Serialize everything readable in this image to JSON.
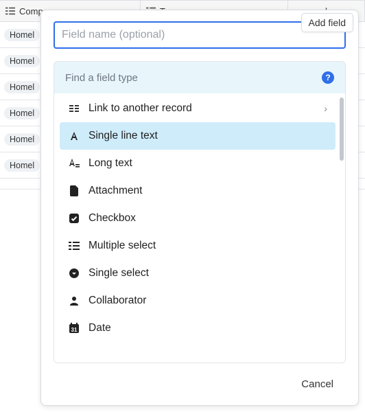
{
  "columns": {
    "company": "Company",
    "tags": "Tags"
  },
  "rows": [
    {
      "company_token": "Homel"
    },
    {
      "company_token": "Homel"
    },
    {
      "company_token": "Homel"
    },
    {
      "company_token": "Homel"
    },
    {
      "company_token": "Homel"
    },
    {
      "company_token": "Homel"
    }
  ],
  "tooltip": {
    "add_field": "Add field"
  },
  "dialog": {
    "fieldname_placeholder": "Field name (optional)",
    "fieldname_value": "",
    "type_search_label": "Find a field type",
    "cancel_label": "Cancel",
    "types": [
      {
        "key": "link",
        "label": "Link to another record",
        "has_submenu": true,
        "selected": false
      },
      {
        "key": "single_line",
        "label": "Single line text",
        "has_submenu": false,
        "selected": true
      },
      {
        "key": "long_text",
        "label": "Long text",
        "has_submenu": false,
        "selected": false
      },
      {
        "key": "attachment",
        "label": "Attachment",
        "has_submenu": false,
        "selected": false
      },
      {
        "key": "checkbox",
        "label": "Checkbox",
        "has_submenu": false,
        "selected": false
      },
      {
        "key": "multi_select",
        "label": "Multiple select",
        "has_submenu": false,
        "selected": false
      },
      {
        "key": "single_select",
        "label": "Single select",
        "has_submenu": false,
        "selected": false
      },
      {
        "key": "collaborator",
        "label": "Collaborator",
        "has_submenu": false,
        "selected": false
      },
      {
        "key": "date",
        "label": "Date",
        "has_submenu": false,
        "selected": false
      }
    ]
  }
}
